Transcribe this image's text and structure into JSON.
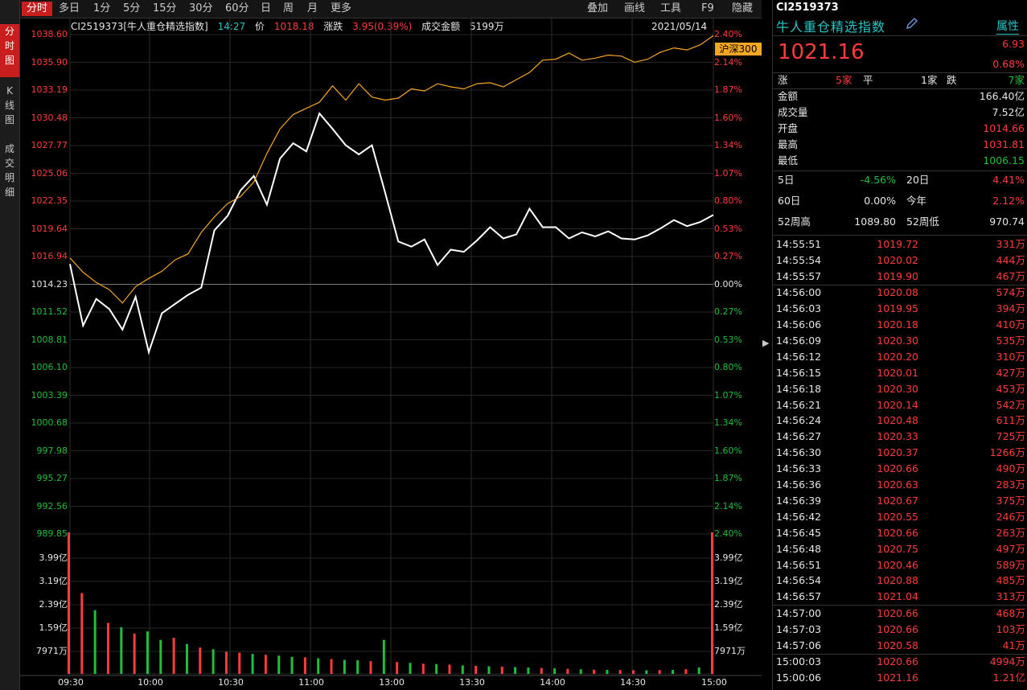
{
  "left_tabs": [
    "分时图",
    "K线图",
    "成交明细"
  ],
  "period_tabs": [
    "分时",
    "多日",
    "1分",
    "5分",
    "15分",
    "30分",
    "60分",
    "日",
    "周",
    "月",
    "更多"
  ],
  "tools": [
    "叠加",
    "画线",
    "工具",
    "F9",
    "隐藏"
  ],
  "info": {
    "code_name": "CI2519373[牛人重仓精选指数]",
    "time": "14:27",
    "price_label": "价",
    "price": "1018.18",
    "change_label": "涨跌",
    "change": "3.95(0.39%)",
    "turnover_label": "成交金额",
    "turnover": "5199万",
    "date": "2021/05/14"
  },
  "price_axis": {
    "upper": [
      "1038.60",
      "1035.90",
      "1033.19",
      "1030.48",
      "1027.77",
      "1025.06",
      "1022.35",
      "1019.64",
      "1016.94"
    ],
    "base": "1014.23",
    "lower": [
      "1011.52",
      "1008.81",
      "1006.10",
      "1003.39",
      "1000.68",
      "997.98",
      "995.27",
      "992.56",
      "989.85"
    ]
  },
  "pct_axis": {
    "upper": [
      "2.40%",
      "2.14%",
      "1.87%",
      "1.60%",
      "1.34%",
      "1.07%",
      "0.80%",
      "0.53%",
      "0.27%"
    ],
    "base": "0.00%",
    "lower": [
      "0.27%",
      "0.53%",
      "0.80%",
      "1.07%",
      "1.34%",
      "1.60%",
      "1.87%",
      "2.14%",
      "2.40%"
    ]
  },
  "hs300_label": "沪深300",
  "volume_axis": [
    "3.99亿",
    "3.19亿",
    "2.39亿",
    "1.59亿",
    "7971万"
  ],
  "time_axis": [
    "09:30",
    "10:00",
    "10:30",
    "11:00",
    "13:00",
    "13:30",
    "14:00",
    "14:30",
    "15:00"
  ],
  "colors": {
    "up": "#ff3b3b",
    "down": "#1fbf3a",
    "index_line": "#ffffff",
    "hs300_line": "#f5a623",
    "accent": "#c81e1e"
  },
  "chart_data": {
    "type": "line",
    "x_ticks": [
      "09:30",
      "10:00",
      "10:30",
      "11:00",
      "13:00",
      "13:30",
      "14:00",
      "14:30",
      "15:00"
    ],
    "ylim": [
      989.85,
      1038.6
    ],
    "base": 1014.23,
    "series": [
      {
        "name": "CI2519373",
        "values": [
          1016.2,
          1010.2,
          1012.8,
          1011.8,
          1009.8,
          1013.0,
          1007.6,
          1011.4,
          1012.3,
          1013.2,
          1013.9,
          1019.5,
          1020.9,
          1023.4,
          1024.8,
          1022.0,
          1026.5,
          1028.0,
          1027.2,
          1030.9,
          1029.4,
          1027.8,
          1026.9,
          1027.8,
          1023.2,
          1018.4,
          1017.9,
          1018.6,
          1016.1,
          1017.6,
          1017.4,
          1018.5,
          1019.8,
          1018.7,
          1019.1,
          1021.6,
          1019.8,
          1019.8,
          1018.7,
          1019.3,
          1018.9,
          1019.4,
          1018.7,
          1018.6,
          1019.0,
          1019.7,
          1020.5,
          1019.9,
          1020.3,
          1021.0
        ]
      },
      {
        "name": "沪深300",
        "values": [
          1016.8,
          1015.4,
          1014.4,
          1013.7,
          1012.4,
          1014.0,
          1014.8,
          1015.5,
          1016.6,
          1017.2,
          1019.3,
          1020.8,
          1022.1,
          1022.8,
          1024.2,
          1027.0,
          1029.4,
          1030.8,
          1031.4,
          1032.0,
          1033.6,
          1032.2,
          1033.8,
          1032.5,
          1032.2,
          1032.4,
          1033.3,
          1033.1,
          1033.8,
          1033.5,
          1033.3,
          1033.8,
          1033.9,
          1033.5,
          1034.2,
          1034.9,
          1036.1,
          1036.2,
          1036.8,
          1036.1,
          1036.3,
          1036.6,
          1036.5,
          1035.9,
          1036.2,
          1036.9,
          1037.3,
          1037.1,
          1037.6,
          1038.5
        ]
      }
    ],
    "volume": {
      "unit": "万",
      "values": [
        3400,
        1900,
        1500,
        1200,
        1100,
        950,
        1000,
        800,
        850,
        700,
        620,
        580,
        520,
        500,
        470,
        450,
        430,
        400,
        390,
        370,
        350,
        330,
        320,
        300,
        800,
        280,
        260,
        240,
        230,
        220,
        200,
        190,
        180,
        170,
        160,
        150,
        140,
        130,
        120,
        110,
        100,
        95,
        90,
        88,
        85,
        90,
        95,
        110,
        150,
        4994
      ],
      "colors": [
        "r",
        "r",
        "g",
        "r",
        "g",
        "r",
        "g",
        "g",
        "r",
        "g",
        "r",
        "g",
        "r",
        "r",
        "g",
        "r",
        "g",
        "g",
        "r",
        "g",
        "r",
        "g",
        "g",
        "r",
        "g",
        "r",
        "g",
        "r",
        "g",
        "r",
        "g",
        "r",
        "g",
        "r",
        "g",
        "g",
        "r",
        "g",
        "r",
        "g",
        "r",
        "g",
        "r",
        "r",
        "g",
        "r",
        "g",
        "r",
        "g",
        "r"
      ]
    }
  },
  "panel": {
    "code": "CI2519373",
    "name": "牛人重仓精选指数",
    "attr_tab": "属性",
    "price": "1021.16",
    "chg": "6.93",
    "chg_pct": "0.68%",
    "breadth": {
      "up_label": "涨",
      "up": "5家",
      "flat_label": "平",
      "flat": "1家",
      "down_label": "跌",
      "down": "7家"
    },
    "stats": [
      {
        "label": "金额",
        "value": "166.40亿",
        "c": "white"
      },
      {
        "label": "成交量",
        "value": "7.52亿",
        "c": "white"
      },
      {
        "label": "开盘",
        "value": "1014.66",
        "c": "red"
      },
      {
        "label": "最高",
        "value": "1031.81",
        "c": "red"
      },
      {
        "label": "最低",
        "value": "1006.15",
        "c": "green"
      }
    ],
    "perf": [
      {
        "l1": "5日",
        "v1": "-4.56%",
        "c1": "green",
        "l2": "20日",
        "v2": "4.41%",
        "c2": "red"
      },
      {
        "l1": "60日",
        "v1": "0.00%",
        "c1": "white",
        "l2": "今年",
        "v2": "2.12%",
        "c2": "red"
      },
      {
        "l1": "52周高",
        "v1": "1089.80",
        "c1": "white",
        "l2": "52周低",
        "v2": "970.74",
        "c2": "white"
      }
    ],
    "ticks": [
      {
        "t": "14:55:51",
        "p": "1019.72",
        "v": "331万"
      },
      {
        "t": "14:55:54",
        "p": "1020.02",
        "v": "444万"
      },
      {
        "t": "14:55:57",
        "p": "1019.90",
        "v": "467万"
      },
      {
        "t": "14:56:00",
        "p": "1020.08",
        "v": "574万"
      },
      {
        "t": "14:56:03",
        "p": "1019.95",
        "v": "394万"
      },
      {
        "t": "14:56:06",
        "p": "1020.18",
        "v": "410万"
      },
      {
        "t": "14:56:09",
        "p": "1020.30",
        "v": "535万"
      },
      {
        "t": "14:56:12",
        "p": "1020.20",
        "v": "310万"
      },
      {
        "t": "14:56:15",
        "p": "1020.01",
        "v": "427万"
      },
      {
        "t": "14:56:18",
        "p": "1020.30",
        "v": "453万"
      },
      {
        "t": "14:56:21",
        "p": "1020.14",
        "v": "542万"
      },
      {
        "t": "14:56:24",
        "p": "1020.48",
        "v": "611万"
      },
      {
        "t": "14:56:27",
        "p": "1020.33",
        "v": "725万"
      },
      {
        "t": "14:56:30",
        "p": "1020.37",
        "v": "1266万"
      },
      {
        "t": "14:56:33",
        "p": "1020.66",
        "v": "490万"
      },
      {
        "t": "14:56:36",
        "p": "1020.63",
        "v": "283万"
      },
      {
        "t": "14:56:39",
        "p": "1020.67",
        "v": "375万"
      },
      {
        "t": "14:56:42",
        "p": "1020.55",
        "v": "246万"
      },
      {
        "t": "14:56:45",
        "p": "1020.66",
        "v": "263万"
      },
      {
        "t": "14:56:48",
        "p": "1020.75",
        "v": "497万"
      },
      {
        "t": "14:56:51",
        "p": "1020.46",
        "v": "589万"
      },
      {
        "t": "14:56:54",
        "p": "1020.88",
        "v": "485万"
      },
      {
        "t": "14:56:57",
        "p": "1021.04",
        "v": "313万"
      },
      {
        "t": "14:57:00",
        "p": "1020.66",
        "v": "468万"
      },
      {
        "t": "14:57:03",
        "p": "1020.66",
        "v": "103万"
      },
      {
        "t": "14:57:06",
        "p": "1020.58",
        "v": "41万"
      },
      {
        "t": "15:00:03",
        "p": "1020.66",
        "v": "4994万"
      },
      {
        "t": "15:00:06",
        "p": "1021.16",
        "v": "1.21亿"
      }
    ]
  }
}
